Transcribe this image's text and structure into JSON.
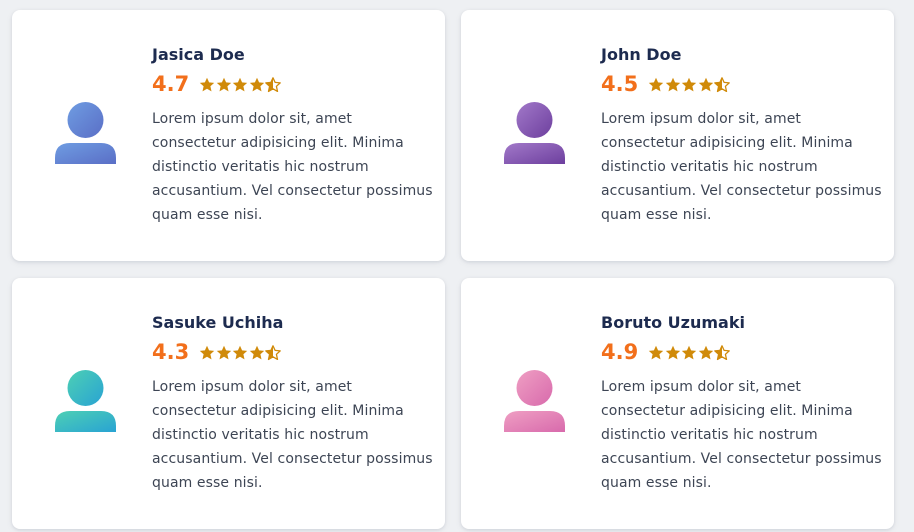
{
  "review_text": "Lorem ipsum dolor sit, amet consectetur adipisicing elit. Minima distinctio veritatis hic nostrum accusantium. Vel consectetur possimus quam esse nisi.",
  "colors": {
    "page_background": "#eef0f3",
    "card_background": "#ffffff",
    "name": "#1d2b4f",
    "rating": "#f26f1b",
    "star": "#d08a09",
    "text": "#3d4554"
  },
  "cards": [
    {
      "name": "Jasica Doe",
      "rating": "4.7",
      "stars": 4.5,
      "avatar_icon": "user-avatar-icon",
      "avatar_gradient": [
        "#6f9de2",
        "#5a6ec6"
      ],
      "text": "Lorem ipsum dolor sit, amet consectetur adipisicing elit. Minima distinctio veritatis hic nostrum accusantium. Vel consectetur possimus quam esse nisi."
    },
    {
      "name": "John Doe",
      "rating": "4.5",
      "stars": 4.5,
      "avatar_icon": "user-avatar-icon",
      "avatar_gradient": [
        "#a279c9",
        "#6d3f9e"
      ],
      "text": "Lorem ipsum dolor sit, amet consectetur adipisicing elit. Minima distinctio veritatis hic nostrum accusantium. Vel consectetur possimus quam esse nisi."
    },
    {
      "name": "Sasuke Uchiha",
      "rating": "4.3",
      "stars": 4.5,
      "avatar_icon": "user-avatar-icon",
      "avatar_gradient": [
        "#4dd0b4",
        "#29a3d3"
      ],
      "text": "Lorem ipsum dolor sit, amet consectetur adipisicing elit. Minima distinctio veritatis hic nostrum accusantium. Vel consectetur possimus quam esse nisi."
    },
    {
      "name": "Boruto Uzumaki",
      "rating": "4.9",
      "stars": 4.5,
      "avatar_icon": "user-avatar-icon",
      "avatar_gradient": [
        "#ef9fc3",
        "#d86aac"
      ],
      "text": "Lorem ipsum dolor sit, amet consectetur adipisicing elit. Minima distinctio veritatis hic nostrum accusantium. Vel consectetur possimus quam esse nisi."
    }
  ]
}
